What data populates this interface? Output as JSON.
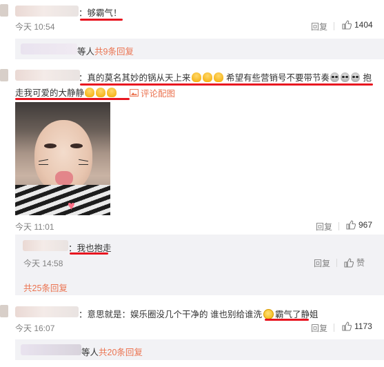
{
  "comments": [
    {
      "text_suffix": "：够霸气！",
      "time": "今天 10:54",
      "reply_label": "回复",
      "likes": "1404",
      "sub_summary": {
        "name_tail": "等人",
        "count_text": "共9条回复"
      }
    },
    {
      "text_line1": "：真的莫名其妙的锅从天上来",
      "text_line1b": "希望有些营销号不要带节奏",
      "text_line1c": "抱",
      "text_line2": "走我可爱的大静静",
      "pic_link": "评论配图",
      "time": "今天 11:01",
      "reply_label": "回复",
      "likes": "967",
      "sub_reply": {
        "text": "：我也抱走",
        "time": "今天 14:58",
        "reply_label": "回复",
        "like_label": "赞"
      },
      "more_replies": "共25条回复"
    },
    {
      "text_a": "：意思就是：娱乐圈没几个干净的 谁也别给谁洗",
      "text_b": "霸气了静姐",
      "time": "今天 16:07",
      "reply_label": "回复",
      "likes": "1173",
      "sub_summary": {
        "name_tail": "等人",
        "count_text": "共20条回复"
      }
    }
  ],
  "colors": {
    "accent": "#eb7350",
    "underline": "#e8141f",
    "muted": "#808080"
  },
  "icons": [
    "thumbs-up-icon",
    "image-icon",
    "emoji-icon",
    "alien-emoji-icon",
    "hug-emoji-icon",
    "thinking-emoji-icon"
  ]
}
